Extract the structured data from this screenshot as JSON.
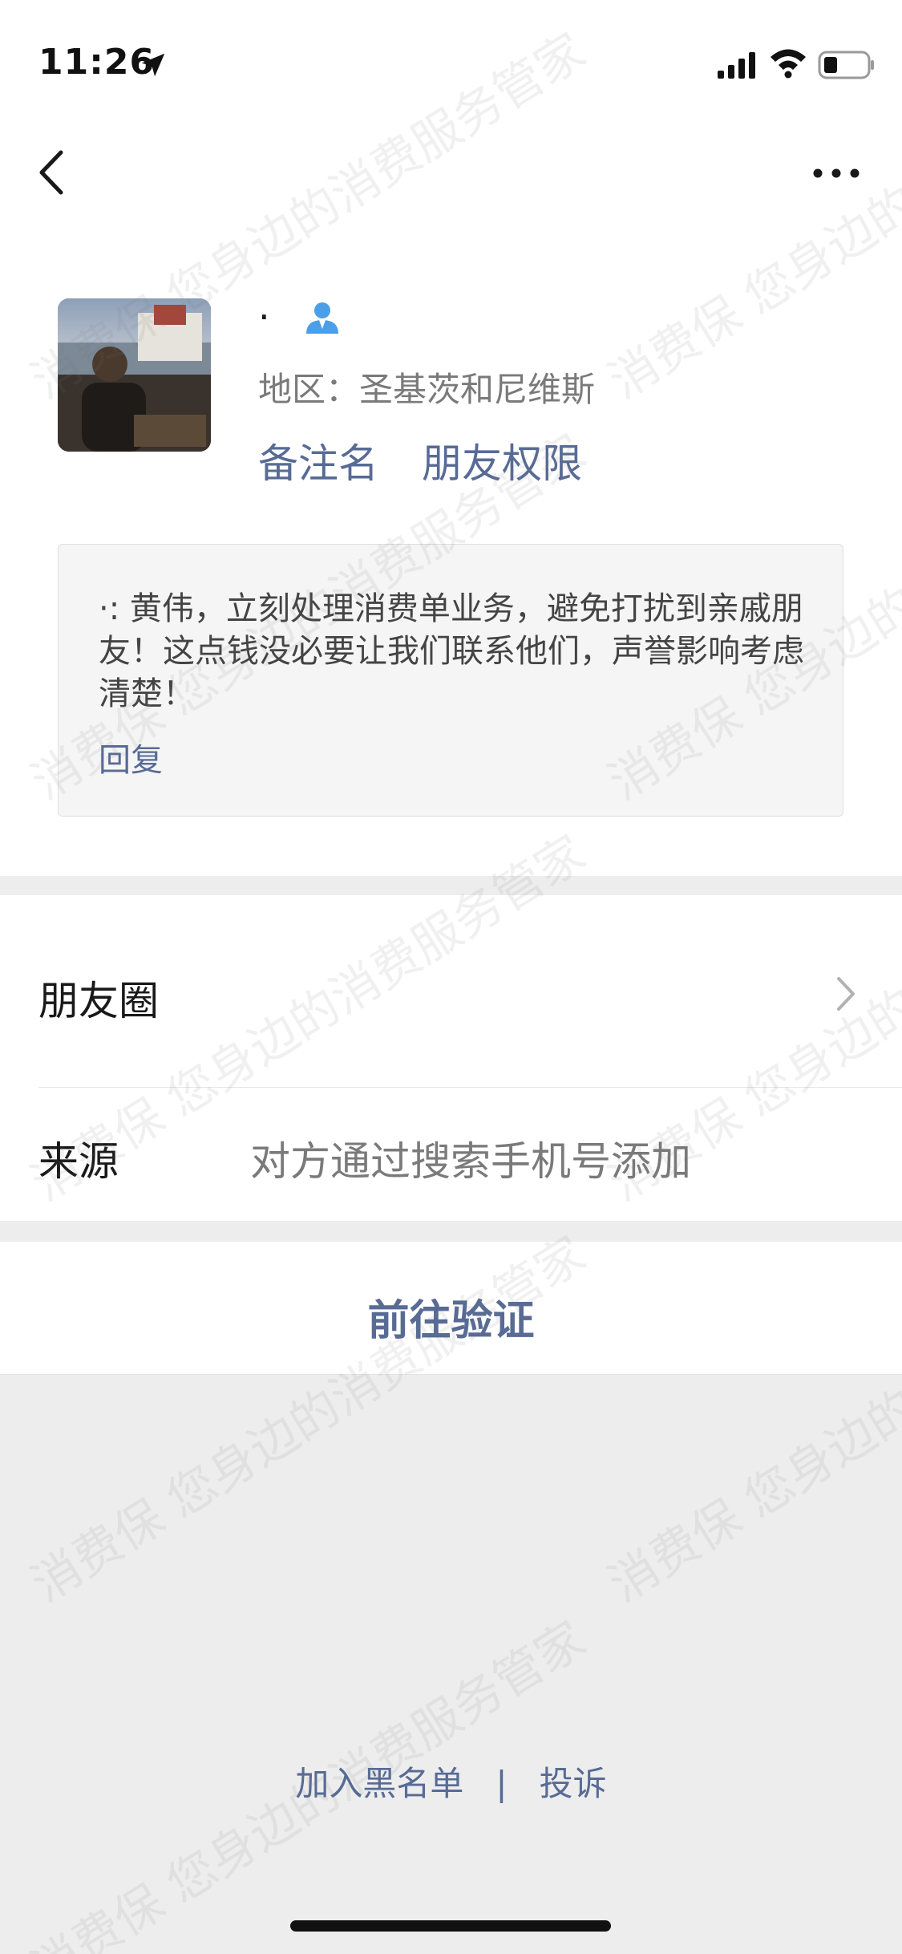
{
  "status_bar": {
    "time": "11:26"
  },
  "profile": {
    "nickname": "·",
    "region": "地区：圣基茨和尼维斯",
    "remark_label": "备注名",
    "permission_label": "朋友权限"
  },
  "greeting": {
    "text": "·: 黄伟，立刻处理消费单业务，避免打扰到亲戚朋友！这点钱没必要让我们联系他们，声誉影响考虑清楚！",
    "reply_label": "回复"
  },
  "list": {
    "moments_label": "朋友圈",
    "source_label": "来源",
    "source_value": "对方通过搜索手机号添加"
  },
  "verify_button_label": "前往验证",
  "footer": {
    "blacklist_label": "加入黑名单",
    "separator": "|",
    "complain_label": "投诉"
  },
  "watermark": {
    "text": "消费保 您身边的消费服务管家"
  },
  "colors": {
    "link": "#576b95",
    "gender_icon": "#4a9fe8",
    "background_gray": "#ededed"
  },
  "icons": [
    "location-arrow-icon",
    "signal-icon",
    "wifi-icon",
    "battery-icon",
    "back-icon",
    "more-icon",
    "gender-male-icon",
    "chevron-right-icon"
  ]
}
